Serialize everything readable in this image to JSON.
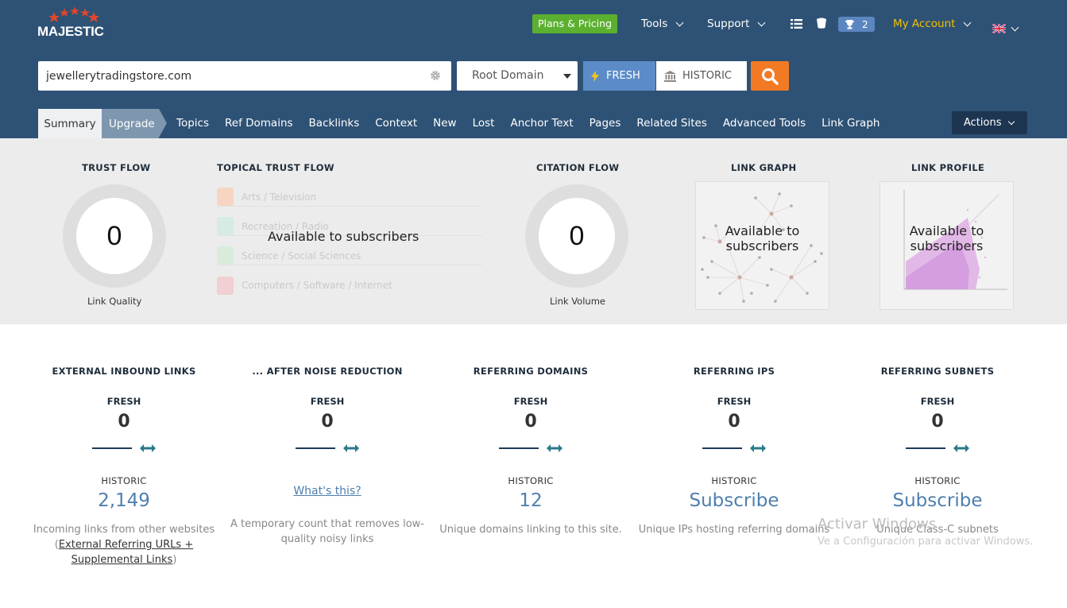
{
  "header": {
    "logo_text": "MAJESTIC",
    "plans_label": "Plans & Pricing",
    "tools_label": "Tools",
    "support_label": "Support",
    "trophy_count": "2",
    "account_label": "My Account"
  },
  "search": {
    "value": "jewellerytradingstore.com",
    "scope": "Root Domain",
    "fresh_label": "FRESH",
    "historic_label": "HISTORIC"
  },
  "tabs": {
    "summary": "Summary",
    "upgrade": "Upgrade",
    "items": [
      "Topics",
      "Ref Domains",
      "Backlinks",
      "Context",
      "New",
      "Lost",
      "Anchor Text",
      "Pages",
      "Related Sites",
      "Advanced Tools",
      "Link Graph"
    ],
    "actions_label": "Actions"
  },
  "flows": {
    "trust_flow": {
      "title": "TRUST FLOW",
      "value": "0",
      "caption": "Link Quality"
    },
    "topical": {
      "title": "TOPICAL TRUST FLOW",
      "topics": [
        "Arts / Television",
        "Recreation / Radio",
        "Science / Social Sciences",
        "Computers / Software / Internet"
      ],
      "overlay": "Available to subscribers"
    },
    "citation_flow": {
      "title": "CITATION FLOW",
      "value": "0",
      "caption": "Link Volume"
    },
    "link_graph": {
      "title": "LINK GRAPH",
      "overlay_1": "Available to",
      "overlay_2": "subscribers"
    },
    "link_profile": {
      "title": "LINK PROFILE",
      "overlay_1": "Available to",
      "overlay_2": "subscribers"
    }
  },
  "stats": [
    {
      "title": "EXTERNAL INBOUND LINKS",
      "fresh_label": "FRESH",
      "fresh_value": "0",
      "historic_label": "HISTORIC",
      "historic_value": "2,149",
      "desc_1": "Incoming links from other websites (",
      "desc_link": "External Referring URLs + Supplemental Links",
      "desc_2": ")"
    },
    {
      "title": "... AFTER NOISE REDUCTION",
      "fresh_label": "FRESH",
      "fresh_value": "0",
      "historic_label": "",
      "historic_value": "What's this?",
      "desc": "A temporary count that removes low-quality noisy links"
    },
    {
      "title": "REFERRING DOMAINS",
      "fresh_label": "FRESH",
      "fresh_value": "0",
      "historic_label": "HISTORIC",
      "historic_value": "12",
      "desc": "Unique domains linking to this site."
    },
    {
      "title": "REFERRING IPS",
      "fresh_label": "FRESH",
      "fresh_value": "0",
      "historic_label": "HISTORIC",
      "historic_value": "Subscribe",
      "desc": "Unique IPs hosting referring domains"
    },
    {
      "title": "REFERRING SUBNETS",
      "fresh_label": "FRESH",
      "fresh_value": "0",
      "historic_label": "HISTORIC",
      "historic_value": "Subscribe",
      "desc": "Unique Class-C subnets"
    }
  ],
  "watermark": {
    "line1": "Activar Windows",
    "line2": "Ve a Configuración para activar Windows."
  },
  "colors": {
    "header_bg": "#2e5275",
    "plans_green": "#5cb030",
    "account_yellow": "#f2c200",
    "fresh_blue": "#5b8cc8",
    "search_orange": "#f37a24",
    "link_blue": "#4f7fae"
  }
}
